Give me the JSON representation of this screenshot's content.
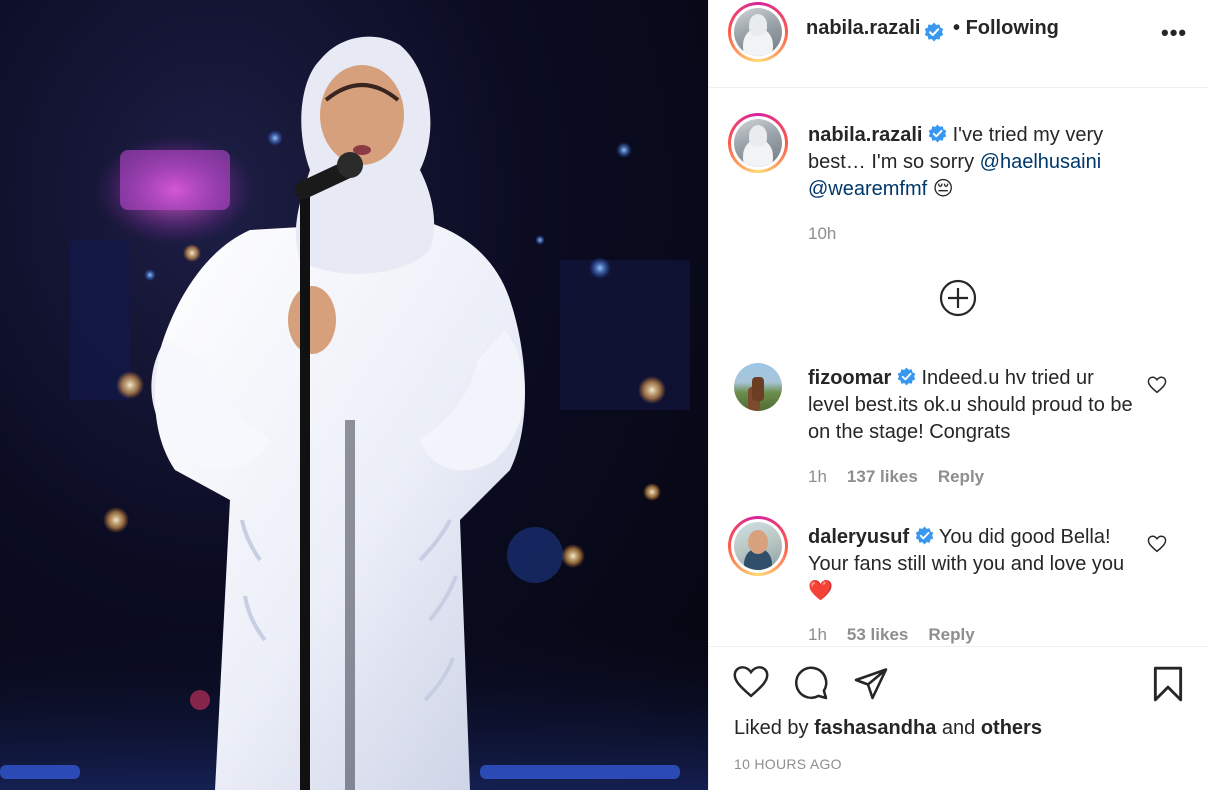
{
  "post": {
    "author": "nabila.razali",
    "follow_status": "Following",
    "more_label": "•••"
  },
  "caption": {
    "username": "nabila.razali",
    "text_part1": "I've tried my very best… I'm so sorry ",
    "mention1": "@haelhusaini",
    "mention2": "@wearemfmf",
    "emoji": "😔",
    "time": "10h"
  },
  "comments": [
    {
      "username": "fizoomar",
      "text": "Indeed.u hv tried ur level best.its ok.u should proud to be on the stage! Congrats",
      "time": "1h",
      "likes": "137 likes",
      "reply": "Reply"
    },
    {
      "username": "daleryusuf",
      "text": "You did good Bella! Your fans still with you and love you",
      "emoji": "❤️",
      "time": "1h",
      "likes": "53 likes",
      "reply": "Reply"
    }
  ],
  "likes_summary": {
    "prefix": "Liked by",
    "user": "fashasandha",
    "middle": "and",
    "others": "others"
  },
  "posted_time": "10 HOURS AGO",
  "icons": [
    "verified-badge-icon",
    "load-more-plus-icon",
    "heart-icon",
    "comment-icon",
    "share-icon",
    "save-bookmark-icon"
  ],
  "colors": {
    "verified_blue": "#3897f0",
    "mention_link": "#00376b",
    "heart_red": "#ed4956",
    "muted_text": "#8e8e8e"
  }
}
